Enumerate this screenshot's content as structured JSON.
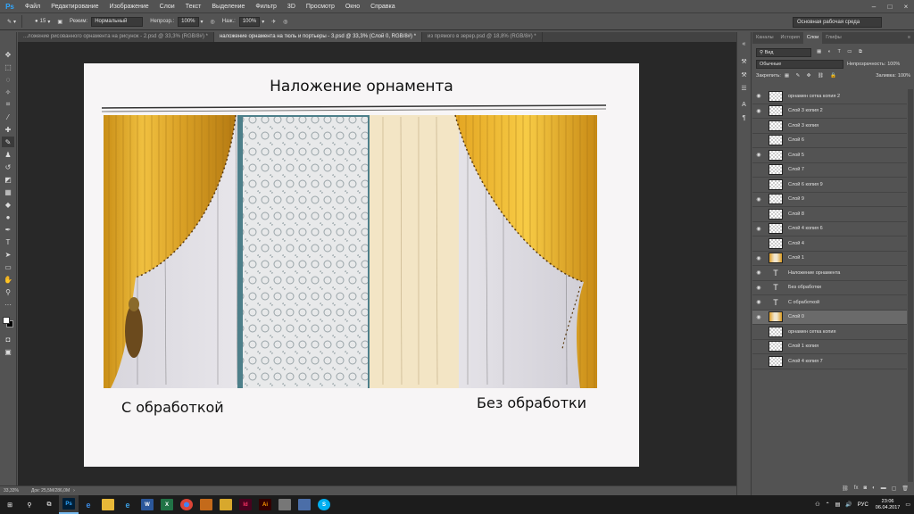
{
  "app": {
    "logo": "Ps"
  },
  "menu": [
    "Файл",
    "Редактирование",
    "Изображение",
    "Слои",
    "Текст",
    "Выделение",
    "Фильтр",
    "3D",
    "Просмотр",
    "Окно",
    "Справка"
  ],
  "options": {
    "brush_size": "15",
    "mode_label": "Режим:",
    "mode_value": "Нормальный",
    "opacity_label": "Непрозр.:",
    "opacity_value": "100%",
    "flow_label": "Наж.:",
    "flow_value": "100%",
    "workspace": "Основная рабочая среда"
  },
  "tabs": [
    "...ложение рисованного орнамента на рисунок - 2.psd @ 33,3% (RGB/8#) *",
    "наложение орнамента на тюль и портьеры - 3.psd @ 33,3% (Слой 0, RGB/8#) *",
    "из прямого в зерер.psd @ 18,8% (RGB/8#) *"
  ],
  "document": {
    "title": "Наложение орнамента",
    "label_left": "С обработкой",
    "label_right": "Без обработки"
  },
  "status": {
    "zoom": "33,33%",
    "doc": "Док: 25,5M/286,0M"
  },
  "panel": {
    "tabs": [
      "Каналы",
      "История",
      "Слои",
      "Глифы"
    ],
    "filter_label": "Вид",
    "blend_mode": "Обычные",
    "opacity_label": "Непрозрачность:",
    "opacity_value": "100%",
    "lock_label": "Закрепить:",
    "fill_label": "Заливка:",
    "fill_value": "100%"
  },
  "layers": [
    {
      "name": "орнамен сетка копия 2",
      "visible": true,
      "kind": "raster"
    },
    {
      "name": "Слой 3 копия 2",
      "visible": true,
      "kind": "raster"
    },
    {
      "name": "Слой 3 копия",
      "visible": false,
      "kind": "raster"
    },
    {
      "name": "Слой 6",
      "visible": false,
      "kind": "raster"
    },
    {
      "name": "Слой 5",
      "visible": true,
      "kind": "raster"
    },
    {
      "name": "Слой 7",
      "visible": false,
      "kind": "raster"
    },
    {
      "name": "Слой 6 копия 9",
      "visible": false,
      "kind": "raster"
    },
    {
      "name": "Слой 9",
      "visible": true,
      "kind": "raster"
    },
    {
      "name": "Слой 8",
      "visible": false,
      "kind": "raster"
    },
    {
      "name": "Слой 4 копия 6",
      "visible": true,
      "kind": "raster"
    },
    {
      "name": "Слой 4",
      "visible": false,
      "kind": "raster"
    },
    {
      "name": "Слой 1",
      "visible": true,
      "kind": "image"
    },
    {
      "name": "Наложение орнамента",
      "visible": true,
      "kind": "text"
    },
    {
      "name": "Без обработки",
      "visible": true,
      "kind": "text"
    },
    {
      "name": "С обработкой",
      "visible": true,
      "kind": "text"
    },
    {
      "name": "Слой 0",
      "visible": true,
      "kind": "image",
      "selected": true
    },
    {
      "name": "орнамен сетка копия",
      "visible": false,
      "kind": "raster"
    },
    {
      "name": "Слой 1 копия",
      "visible": false,
      "kind": "raster"
    },
    {
      "name": "Слой 4 копия 7",
      "visible": false,
      "kind": "raster"
    }
  ],
  "taskbar": {
    "lang": "РУС",
    "time": "23:06",
    "date": "06.04.2017"
  }
}
